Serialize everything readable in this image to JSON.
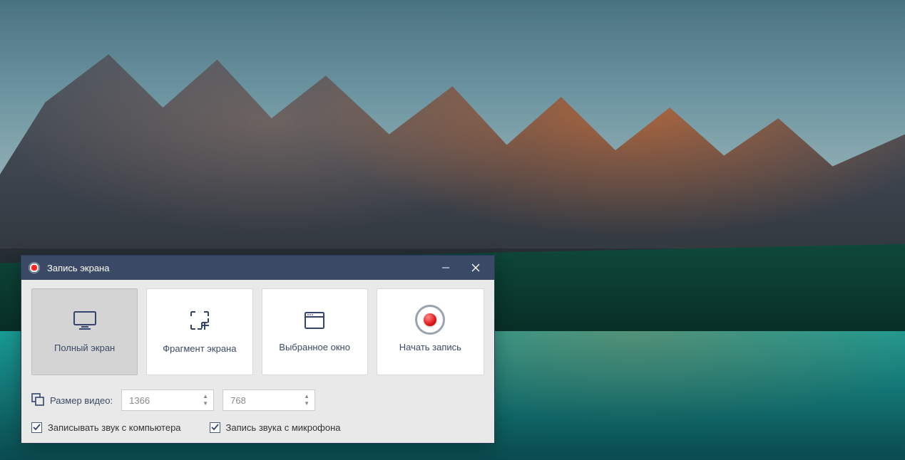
{
  "window": {
    "title": "Запись экрана"
  },
  "modes": {
    "fullscreen": "Полный экран",
    "fragment": "Фрагмент экрана",
    "selected_window": "Выбранное окно"
  },
  "record": {
    "label": "Начать запись"
  },
  "size": {
    "label": "Размер видео:",
    "width": "1366",
    "height": "768"
  },
  "checks": {
    "computer_audio": "Записывать звук с компьютера",
    "mic_audio": "Запись звука с микрофона"
  }
}
